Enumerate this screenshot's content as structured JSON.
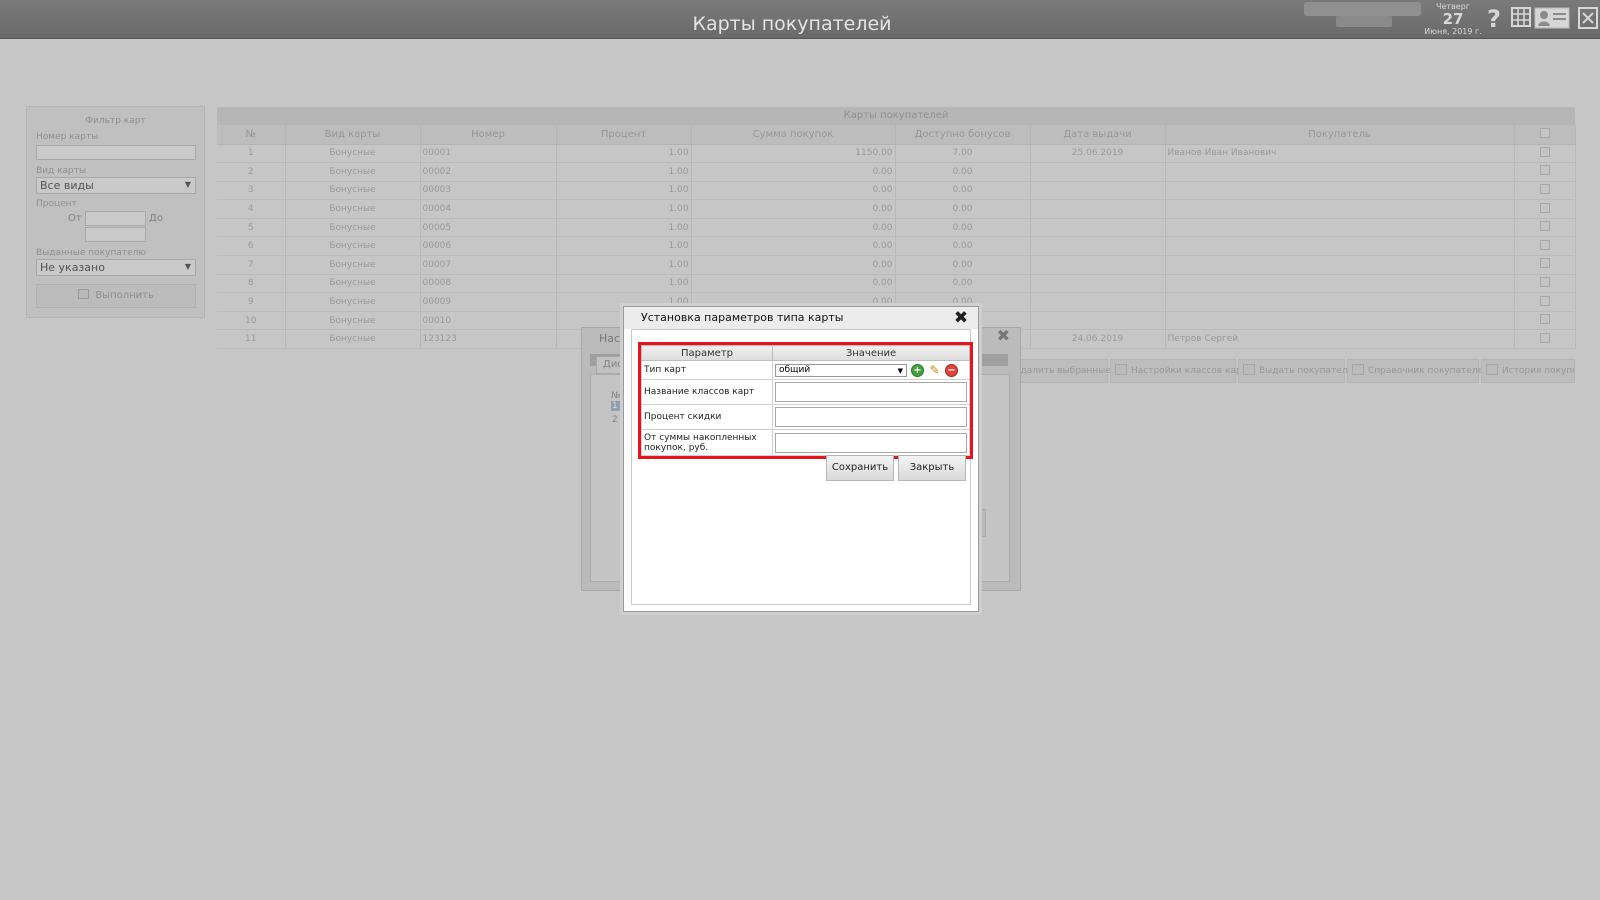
{
  "header": {
    "title": "Карты покупателей",
    "date_weekday": "Четверг",
    "date_day": "27",
    "date_month": "Июня, 2019 г.",
    "help_icon": "question-icon",
    "icons": [
      "question-icon",
      "grid-icon",
      "profile-card-icon",
      "exit-icon"
    ]
  },
  "filter": {
    "title": "Фильтр карт",
    "card_number_label": "Номер карты",
    "card_number_value": "",
    "card_type_label": "Вид карты",
    "card_type_value": "Все виды",
    "percent_label": "Процент",
    "from_label": "От",
    "to_label": "До",
    "issued_label": "Выданные покупателю",
    "issued_value": "Не указано",
    "run_label": "Выполнить"
  },
  "grid": {
    "caption": "Карты покупателей",
    "columns": [
      "№",
      "Вид карты",
      "Номер",
      "Процент",
      "Сумма покупок",
      "Доступно бонусов",
      "Дата выдачи",
      "Покупатель"
    ],
    "rows": [
      [
        "1",
        "Бонусные",
        "00001",
        "1.00",
        "1150.00",
        "7.00",
        "25.06.2019",
        "Иванов Иван Иванович"
      ],
      [
        "2",
        "Бонусные",
        "00002",
        "1.00",
        "0.00",
        "0.00",
        "",
        ""
      ],
      [
        "3",
        "Бонусные",
        "00003",
        "1.00",
        "0.00",
        "0.00",
        "",
        ""
      ],
      [
        "4",
        "Бонусные",
        "00004",
        "1.00",
        "0.00",
        "0.00",
        "",
        ""
      ],
      [
        "5",
        "Бонусные",
        "00005",
        "1.00",
        "0.00",
        "0.00",
        "",
        ""
      ],
      [
        "6",
        "Бонусные",
        "00006",
        "1.00",
        "0.00",
        "0.00",
        "",
        ""
      ],
      [
        "7",
        "Бонусные",
        "00007",
        "1.00",
        "0.00",
        "0.00",
        "",
        ""
      ],
      [
        "8",
        "Бонусные",
        "00008",
        "1.00",
        "0.00",
        "0.00",
        "",
        ""
      ],
      [
        "9",
        "Бонусные",
        "00009",
        "1.00",
        "0.00",
        "0.00",
        "",
        ""
      ],
      [
        "10",
        "Бонусные",
        "00010",
        "",
        "",
        "",
        "",
        ""
      ],
      [
        "11",
        "Бонусные",
        "123123",
        "",
        "",
        "",
        "24.06.2019",
        "Петров Сергей"
      ]
    ]
  },
  "toolbar": {
    "delete_selected": "Удалить выбранные",
    "card_class_settings": "Настройки классов карт",
    "issue_to_customer": "Выдать покупателю",
    "customer_directory": "Справочник покупателей",
    "purchase_history": "История покупок"
  },
  "bg_dialog": {
    "title": "Наст",
    "tab": "Дис",
    "col": "№",
    "row1": "1",
    "row2": "2"
  },
  "dialog": {
    "title": "Установка параметров типа карты",
    "col_param": "Параметр",
    "col_value": "Значение",
    "params": [
      {
        "label": "Тип карт",
        "value": "общий"
      },
      {
        "label": "Название классов карт",
        "value": ""
      },
      {
        "label": "Процент скидки",
        "value": ""
      },
      {
        "label": "От суммы накопленных покупок, руб.",
        "value": ""
      }
    ],
    "save_label": "Сохранить",
    "close_label": "Закрыть"
  },
  "colors": {
    "highlight": "#e4151d",
    "header_bg": "#6f6f6f"
  }
}
